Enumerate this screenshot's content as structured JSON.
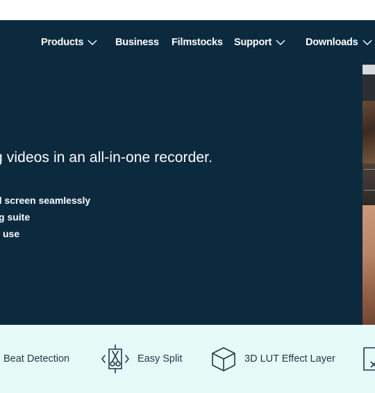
{
  "nav": {
    "items": [
      {
        "label": "Products",
        "has_dropdown": true
      },
      {
        "label": "Business",
        "has_dropdown": false
      },
      {
        "label": "Filmstocks",
        "has_dropdown": false
      },
      {
        "label": "Support",
        "has_dropdown": true
      },
      {
        "label": "Downloads",
        "has_dropdown": true
      }
    ]
  },
  "hero": {
    "headline": "g videos in an all-in-one recorder.",
    "bullets": [
      "d screen seamlessly",
      "g suite",
      "use"
    ]
  },
  "features": {
    "items": [
      {
        "label": "Beat Detection",
        "icon": "beat-detection-icon"
      },
      {
        "label": "Easy Split",
        "icon": "scissors-icon"
      },
      {
        "label": "3D LUT Effect Layer",
        "icon": "cube-icon"
      },
      {
        "label": "",
        "icon": "file-icon"
      }
    ]
  },
  "colors": {
    "hero_bg": "#0b2a3e",
    "features_bg": "#e6faf8",
    "text_dark": "#1f3748",
    "text_light": "#ffffff"
  }
}
